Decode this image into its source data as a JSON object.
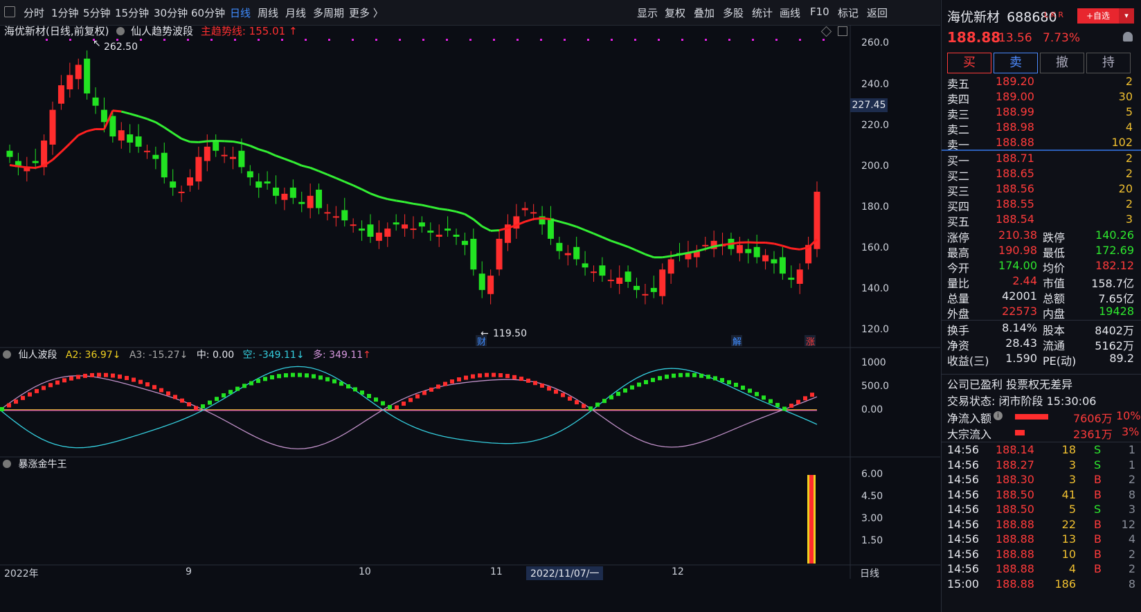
{
  "toolbar": {
    "left_items": [
      "分时",
      "1分钟",
      "5分钟",
      "15分钟",
      "30分钟",
      "60分钟",
      "日线",
      "周线",
      "月线",
      "多周期",
      "更多 〉"
    ],
    "active": "日线",
    "right_items": [
      "显示",
      "复权",
      "叠加",
      "多股",
      "统计",
      "画线",
      "F10",
      "标记",
      "返回"
    ]
  },
  "main_panel": {
    "title": "海优新材(日线,前复权)",
    "indicator": "仙人趋势波段",
    "trend_label": "主趋势线: 155.01",
    "trend_arrow": "↑",
    "high_label": "262.50",
    "low_label": "119.50",
    "current_price_tag": "227.45",
    "y_ticks": [
      "260.0",
      "240.0",
      "220.0",
      "200.0",
      "180.0",
      "160.0",
      "140.0",
      "120.0"
    ],
    "markers": [
      "财",
      "解",
      "涨"
    ]
  },
  "sub_panel_1": {
    "name": "仙人波段",
    "a2": "A2: 36.97",
    "a2_arrow": "↓",
    "a3": "A3: -15.27",
    "a3_arrow": "↓",
    "mid": "中: 0.00",
    "kong": "空: -349.11",
    "kong_arrow": "↓",
    "duo": "多: 349.11",
    "duo_arrow": "↑",
    "y_ticks": [
      "1000",
      "500.0",
      "0.00"
    ]
  },
  "sub_panel_2": {
    "name": "暴涨金牛王",
    "y_ticks": [
      "6.00",
      "4.50",
      "3.00",
      "1.50"
    ]
  },
  "x_axis": {
    "labels": [
      "2022年",
      "9",
      "10",
      "11",
      "2022/11/07/一",
      "12"
    ],
    "period": "日线"
  },
  "quote": {
    "name": "海优新材",
    "code": "688680",
    "badges": "L K R",
    "add_watch": "+自选",
    "price": "188.88",
    "change": "13.56",
    "change_pct": "7.73%",
    "buttons": [
      "买",
      "卖",
      "撤",
      "持"
    ],
    "asks": [
      {
        "label": "卖五",
        "price": "189.20",
        "vol": "2"
      },
      {
        "label": "卖四",
        "price": "189.00",
        "vol": "30"
      },
      {
        "label": "卖三",
        "price": "188.99",
        "vol": "5"
      },
      {
        "label": "卖二",
        "price": "188.98",
        "vol": "4"
      },
      {
        "label": "卖一",
        "price": "188.88",
        "vol": "102"
      }
    ],
    "bids": [
      {
        "label": "买一",
        "price": "188.71",
        "vol": "2"
      },
      {
        "label": "买二",
        "price": "188.65",
        "vol": "2"
      },
      {
        "label": "买三",
        "price": "188.56",
        "vol": "20"
      },
      {
        "label": "买四",
        "price": "188.55",
        "vol": "2"
      },
      {
        "label": "买五",
        "price": "188.54",
        "vol": "3"
      }
    ],
    "stats": [
      [
        "涨停",
        "210.38",
        "跌停",
        "140.26"
      ],
      [
        "最高",
        "190.98",
        "最低",
        "172.69"
      ],
      [
        "今开",
        "174.00",
        "均价",
        "182.12"
      ],
      [
        "量比",
        "2.44",
        "市值",
        "158.7亿"
      ],
      [
        "总量",
        "42001",
        "总额",
        "7.65亿"
      ],
      [
        "外盘",
        "22573",
        "内盘",
        "19428"
      ],
      [
        "换手",
        "8.14%",
        "股本",
        "8402万"
      ],
      [
        "净资",
        "28.43",
        "流通",
        "5162万"
      ],
      [
        "收益(三)",
        "1.590",
        "PE(动)",
        "89.2"
      ]
    ],
    "notice": "公司已盈利 投票权无差异",
    "status": "交易状态: 闭市阶段 15:30:06",
    "net_inflow_label": "净流入额",
    "net_inflow": "7606万",
    "net_inflow_pct": "10%",
    "block_inflow_label": "大宗流入",
    "block_inflow": "2361万",
    "block_inflow_pct": "3%",
    "ticks": [
      {
        "time": "14:56",
        "price": "188.14",
        "vol": "18",
        "side": "S",
        "n": "1"
      },
      {
        "time": "14:56",
        "price": "188.27",
        "vol": "3",
        "side": "S",
        "n": "1"
      },
      {
        "time": "14:56",
        "price": "188.30",
        "vol": "3",
        "side": "B",
        "n": "2"
      },
      {
        "time": "14:56",
        "price": "188.50",
        "vol": "41",
        "side": "B",
        "n": "8"
      },
      {
        "time": "14:56",
        "price": "188.50",
        "vol": "5",
        "side": "S",
        "n": "3"
      },
      {
        "time": "14:56",
        "price": "188.88",
        "vol": "22",
        "side": "B",
        "n": "12"
      },
      {
        "time": "14:56",
        "price": "188.88",
        "vol": "13",
        "side": "B",
        "n": "4"
      },
      {
        "time": "14:56",
        "price": "188.88",
        "vol": "10",
        "side": "B",
        "n": "2"
      },
      {
        "time": "14:56",
        "price": "188.88",
        "vol": "4",
        "side": "B",
        "n": "2"
      },
      {
        "time": "15:00",
        "price": "188.88",
        "vol": "186",
        "side": "",
        "n": "8"
      }
    ]
  },
  "colors": {
    "up": "#ff2d2d",
    "down": "#22e322",
    "trend_up": "#ff2020",
    "trend_down": "#33ee33",
    "bg": "#0b0d14"
  }
}
